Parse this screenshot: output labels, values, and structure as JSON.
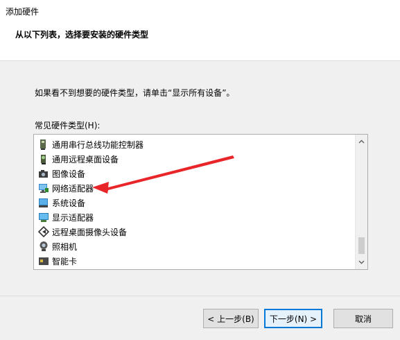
{
  "window": {
    "title": "添加硬件"
  },
  "header": {
    "heading": "从以下列表，选择要安装的硬件类型"
  },
  "main": {
    "instruction": "如果看不到想要的硬件类型，请单击“显示所有设备”。",
    "list_label": "常见硬件类型(H):",
    "items": [
      {
        "label": "通用串行总线功能控制器",
        "icon": "usb-controller-icon"
      },
      {
        "label": "通用远程桌面设备",
        "icon": "remote-desktop-device-icon"
      },
      {
        "label": "图像设备",
        "icon": "camera-icon"
      },
      {
        "label": "网络适配器",
        "icon": "network-adapter-icon"
      },
      {
        "label": "系统设备",
        "icon": "system-device-icon"
      },
      {
        "label": "显示适配器",
        "icon": "display-adapter-icon"
      },
      {
        "label": "远程桌面摄像头设备",
        "icon": "remote-camera-icon"
      },
      {
        "label": "照相机",
        "icon": "webcam-icon"
      },
      {
        "label": "智能卡",
        "icon": "smart-card-icon"
      }
    ]
  },
  "footer": {
    "back_label": "< 上一步(B)",
    "next_label": "下一步(N) >",
    "cancel_label": "取消"
  },
  "annotation": {
    "arrow_color": "#e8262a"
  }
}
